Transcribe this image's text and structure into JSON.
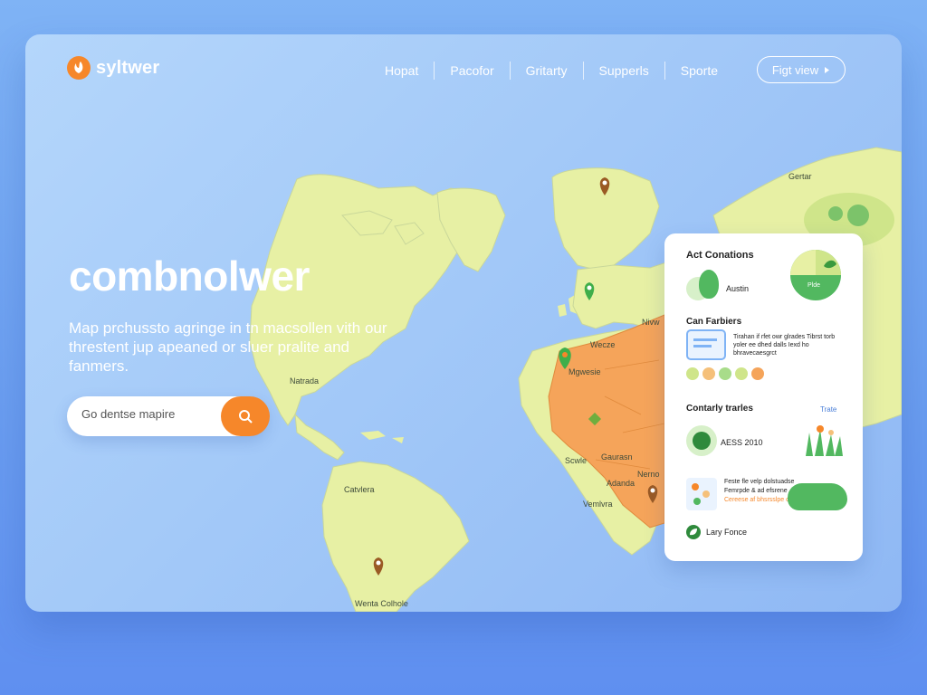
{
  "brand": {
    "name": "syltwer",
    "logo_icon": "flame-leaf-icon",
    "accent": "#f6872a"
  },
  "nav": {
    "links": [
      "Hopat",
      "Pacofor",
      "Gritarty",
      "Supperls",
      "Sporte"
    ],
    "cta_label": "Figt view"
  },
  "hero": {
    "title": "combnolwer",
    "subtitle": "Map prchussto agringe in tn macsollen vith our threstent jup apeaned or sluer pralite and fanmers."
  },
  "search": {
    "placeholder": "Go dentse mapire",
    "icon": "search-icon"
  },
  "map_labels": {
    "north_america": "Natrada",
    "south_america_top": "Catvlera",
    "south_america_bottom": "Wenta Colhole",
    "europe": "Nivw",
    "africa_1": "Wecze",
    "africa_2": "Mgwesie",
    "africa_3": "Gaurasn",
    "africa_4": "Scwle",
    "africa_5": "Adanda",
    "africa_6": "Nerno",
    "africa_7": "Vemlvra",
    "asia": "Gertar"
  },
  "panel": {
    "section1": {
      "title": "Act Conations",
      "item_label": "Austin",
      "chart_label": "Plde"
    },
    "section2": {
      "title": "Can Farbiers",
      "text": "Tirahan if rfet owr glrades Tibrst torb yoler ee dhed dalls Iexd ho bhravecaesgrct"
    },
    "section3": {
      "title": "Contarly trarles",
      "link": "Trate",
      "value": "AESS 2010"
    },
    "section4": {
      "text1": "Feste fle velp dolstuadse",
      "text2": "Femrpde & ad efsrene",
      "text3": "Cereese af bhsrsslpe cod",
      "footer": "Lary Fonce"
    }
  },
  "colors": {
    "land": "#e7f0a4",
    "highlight": "#f5a45a",
    "marker_brown": "#9a5a24",
    "marker_green": "#3fae4a",
    "panel_green": "#52b860"
  }
}
